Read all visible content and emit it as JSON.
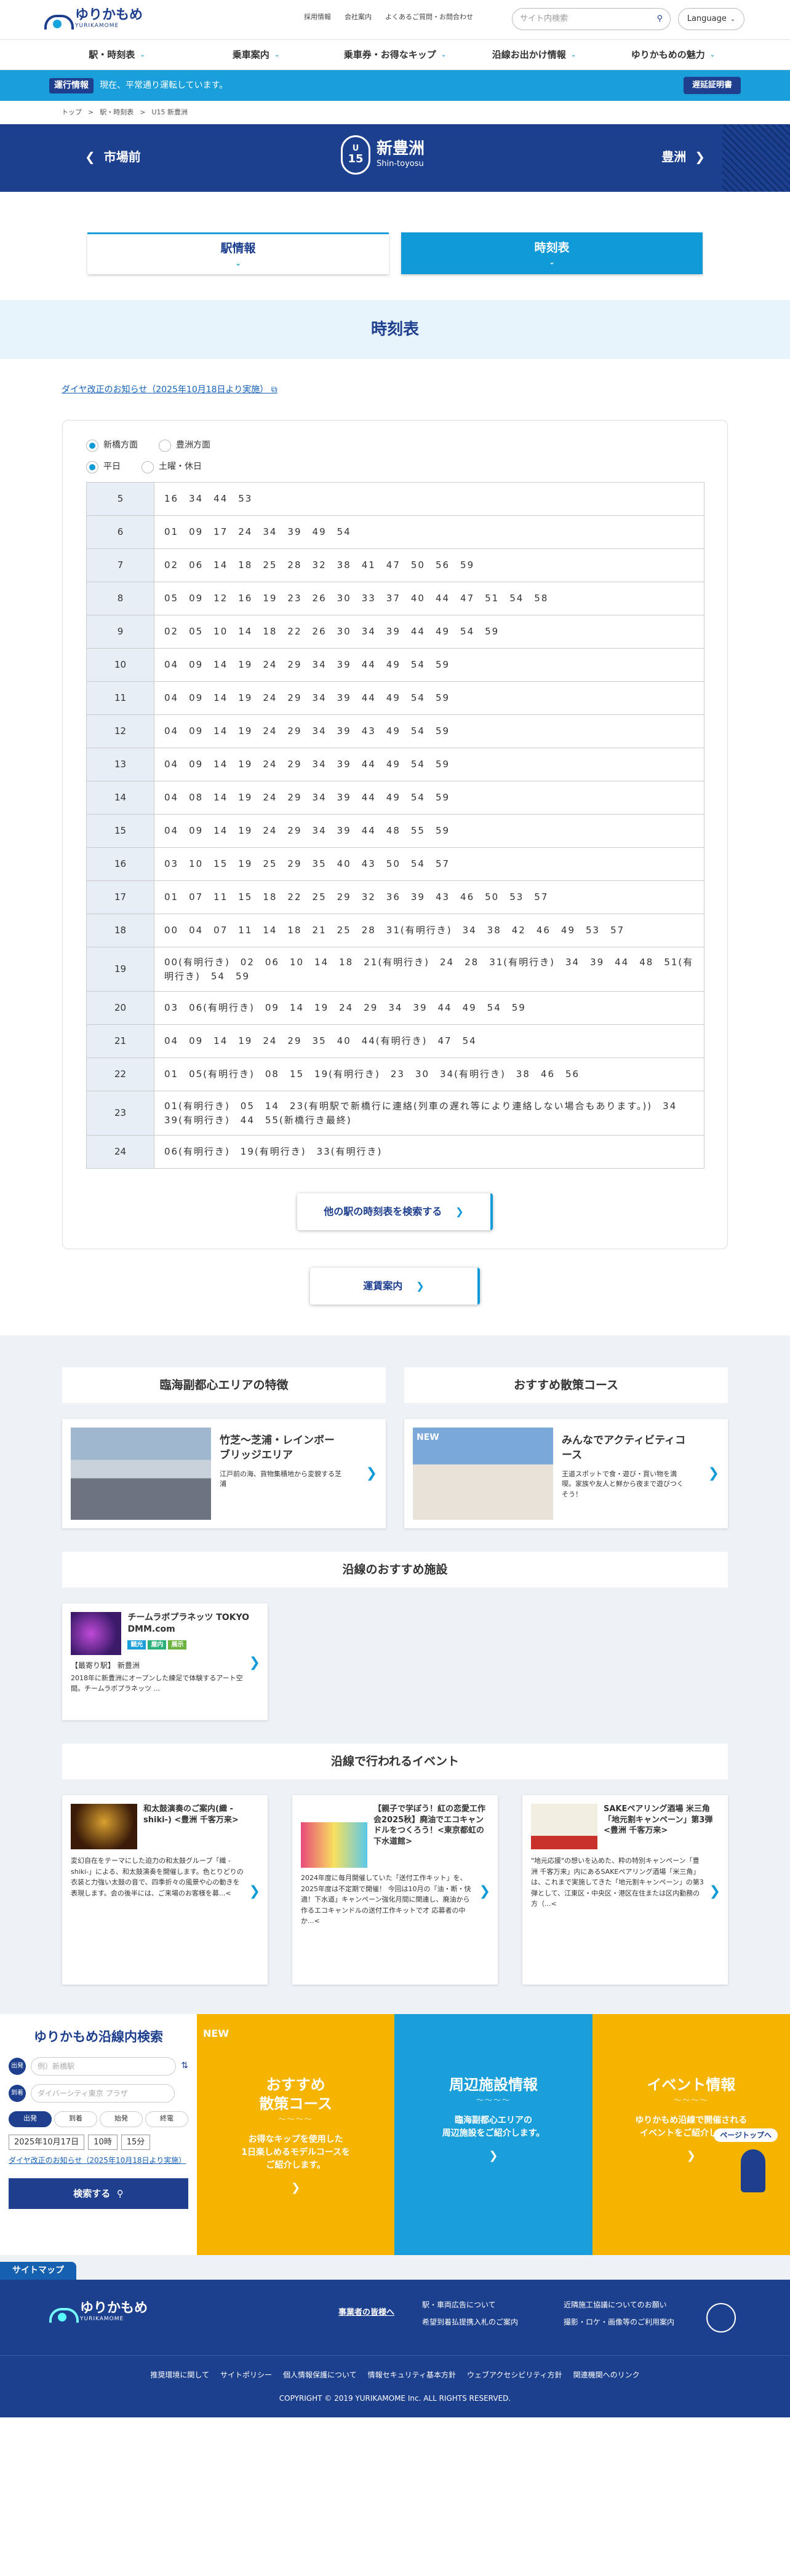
{
  "header": {
    "logo_jp": "ゆりかもめ",
    "logo_en": "YURIKAMOME",
    "links": [
      "採用情報",
      "会社案内",
      "よくあるご質問・お問合わせ"
    ],
    "search_placeholder": "サイト内検索",
    "language": "Language"
  },
  "gnav": [
    "駅・時刻表",
    "乗車案内",
    "乗車券・お得なキップ",
    "沿線お出かけ情報",
    "ゆりかもめの魅力"
  ],
  "alert": {
    "tag": "運行情報",
    "text": "現在、平常通り運転しています。",
    "button": "遅延証明書"
  },
  "breadcrumb": [
    "トップ",
    ">",
    "駅・時刻表",
    ">",
    "U15 新豊洲"
  ],
  "station": {
    "prev": "市場前",
    "next": "豊洲",
    "code_a": "U",
    "code_b": "15",
    "name": "新豊洲",
    "en": "Shin-toyosu"
  },
  "tabs": {
    "info": "駅情報",
    "timetable": "時刻表"
  },
  "section_title": "時刻表",
  "notice": "ダイヤ改正のお知らせ（2025年10月18日より実施）",
  "direction": {
    "a": "新橋方面",
    "b": "豊洲方面"
  },
  "daytype": {
    "a": "平日",
    "b": "土曜・休日"
  },
  "timetable": [
    {
      "h": "5",
      "m": "16　34　44　53"
    },
    {
      "h": "6",
      "m": "01　09　17　24　34　39　49　54"
    },
    {
      "h": "7",
      "m": "02　06　14　18　25　28　32　38　41　47　50　56　59"
    },
    {
      "h": "8",
      "m": "05　09　12　16　19　23　26　30　33　37　40　44　47　51　54　58"
    },
    {
      "h": "9",
      "m": "02　05　10　14　18　22　26　30　34　39　44　49　54　59"
    },
    {
      "h": "10",
      "m": "04　09　14　19　24　29　34　39　44　49　54　59"
    },
    {
      "h": "11",
      "m": "04　09　14　19　24　29　34　39　44　49　54　59"
    },
    {
      "h": "12",
      "m": "04　09　14　19　24　29　34　39　43　49　54　59"
    },
    {
      "h": "13",
      "m": "04　09　14　19　24　29　34　39　44　49　54　59"
    },
    {
      "h": "14",
      "m": "04　08　14　19　24　29　34　39　44　49　54　59"
    },
    {
      "h": "15",
      "m": "04　09　14　19　24　29　34　39　44　48　55　59"
    },
    {
      "h": "16",
      "m": "03　10　15　19　25　29　35　40　43　50　54　57"
    },
    {
      "h": "17",
      "m": "01　07　11　15　18　22　25　29　32　36　39　43　46　50　53　57"
    },
    {
      "h": "18",
      "m": "00　04　07　11　14　18　21　25　28　31(有明行き)　34　38　42　46　49　53　57"
    },
    {
      "h": "19",
      "m": "00(有明行き)　02　06　10　14　18　21(有明行き)　24　28　31(有明行き)　34　39　44　48　51(有明行き)　54　59"
    },
    {
      "h": "20",
      "m": "03　06(有明行き)　09　14　19　24　29　34　39　44　49　54　59"
    },
    {
      "h": "21",
      "m": "04　09　14　19　24　29　35　40　44(有明行き)　47　54"
    },
    {
      "h": "22",
      "m": "01　05(有明行き)　08　15　19(有明行き)　23　30　34(有明行き)　38　46　56"
    },
    {
      "h": "23",
      "m": "01(有明行き)　05　14　23(有明駅で新橋行に連絡(列車の遅れ等により連絡しない場合もあります。))　34　39(有明行き)　44　55(新橋行き最終)"
    },
    {
      "h": "24",
      "m": "06(有明行き)　19(有明行き)　33(有明行き)"
    }
  ],
  "buttons": {
    "other": "他の駅の時刻表を検索する",
    "fare": "運賃案内"
  },
  "features": {
    "title1": "臨海副都心エリアの特徴",
    "title2": "おすすめ散策コース",
    "card1": {
      "title": "竹芝～芝浦・レインボーブリッジエリア",
      "desc": "江戸前の海、貨物集積地から変貌する芝浦"
    },
    "card2": {
      "badge": "NEW",
      "title": "みんなでアクティビティコース",
      "desc": "王道スポットで食・遊び・買い物を満喫。家族や友人と鮮から夜まで遊びつくそう！"
    }
  },
  "facilities": {
    "title": "沿線のおすすめ施設",
    "card": {
      "title": "チームラボプラネッツ TOKYO DMM.com",
      "tags": [
        "観光",
        "屋内",
        "展示"
      ],
      "station": "【最寄り駅】 新豊洲",
      "desc": "2018年に新豊洲にオープンした練足で体験するアート空間。チームラボプラネッツ ..."
    }
  },
  "events": {
    "title": "沿線で行われるイベント",
    "items": [
      {
        "title": "和太鼓演奏のご案内(織 -shiki-) <豊洲 千客万来>",
        "desc": "変幻自在をテーマにした迫力の和太鼓グループ「織 -shiki-」による、和太鼓演奏を開催します。色とりどりの衣装と力強い太鼓の音で、四季折々の風景や心の動きを表現します。会の後半には、ご来場のお客様を募...<"
      },
      {
        "title": "【親子で学ぼう！紅の恋愛工作会2025秋】廃油でエコキャンドルをつくろう！<東京都虹の下水道館>",
        "desc": "2024年度に毎月開催していた「送付工作キット」を、2025年度は不定期で開催！ 今回は10月の「油・断・快適！下水道」キャンペーン強化月間に関連し、廃油から作るエコキャンドルの送付工作キットで才 応募者の中か...<"
      },
      {
        "title": "SAKEペアリング酒場 米三角「地元割キャンペーン」第3弾 <豊洲 千客万来>",
        "desc": "\"地元応援\"の想いを込めた、粋の特別キャンペーン「豊洲 千客万来」内にあるSAKEペアリング酒場「米三角」は、これまで実施してきた「地元割キャンペーン」の第3弾として、江東区・中央区・港区在住または区内勤務の方（...<"
      }
    ]
  },
  "search": {
    "title": "ゆりかもめ沿線内検索",
    "from": "例）新橋駅",
    "to": "ダイバーシティ東京 プラザ",
    "modes": [
      "出発",
      "到着",
      "始発",
      "終電"
    ],
    "date": "2025年10月17日",
    "hour": "10時",
    "min": "15分",
    "notice": "ダイヤ改正のお知らせ（2025年10月18日より実施）",
    "button": "検索する"
  },
  "promos": [
    {
      "badge": "NEW",
      "title": "おすすめ\n散策コース",
      "wave": "～～～～",
      "desc": "お得なキップを使用した\n1日楽しめるモデルコースを\nご紹介します。"
    },
    {
      "title": "周辺施設情報",
      "wave": "～～～～",
      "desc": "臨海副都心エリアの\n周辺施設をご紹介します。"
    },
    {
      "title": "イベント情報",
      "wave": "～～～～",
      "desc": "ゆりかもめ沿線で開催される\nイベントをご紹介します。",
      "top": "ページトップへ"
    }
  ],
  "footer": {
    "sitemap": "サイトマップ",
    "biz": "事業者の皆様へ",
    "links1": [
      "駅・車両広告について",
      "近隣施工協議についてのお願い",
      "希望到着払提携入札のご案内",
      "撮影・ロケ・画像等のご利用案内"
    ],
    "links2": [
      "推奨環境に関して",
      "サイトポリシー",
      "個人情報保護について",
      "情報セキュリティ基本方針",
      "ウェブアクセシビリティ方針",
      "関連機関へのリンク"
    ],
    "copy": "COPYRIGHT © 2019 YURIKAMOME Inc. ALL RIGHTS RESERVED."
  }
}
